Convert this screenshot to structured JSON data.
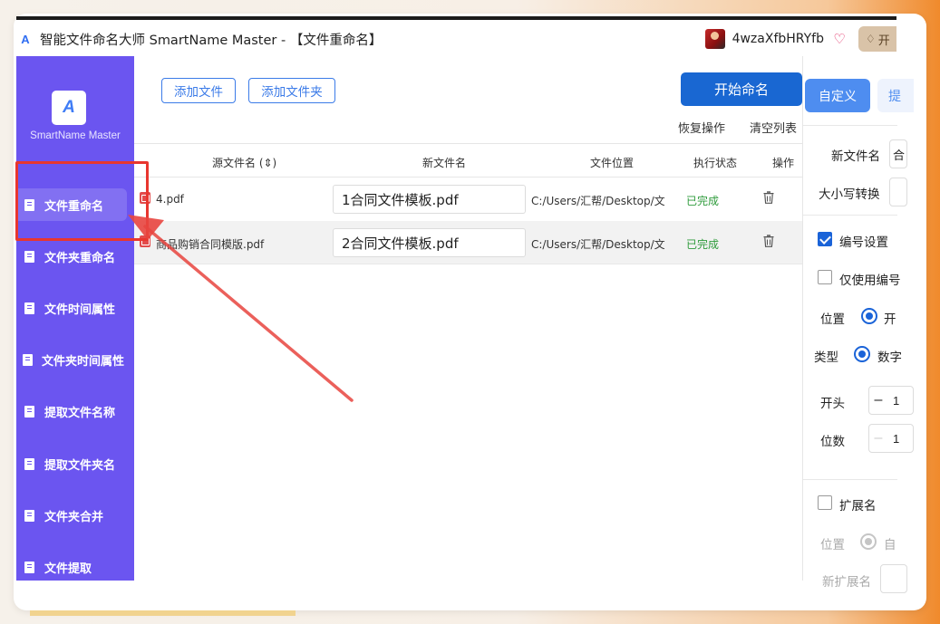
{
  "window": {
    "title": "智能文件命名大师 SmartName Master - 【文件重命名】",
    "username": "4wzaXfbHRYfb",
    "open_vip_label": "开"
  },
  "sidebar": {
    "logo_text": "SmartName Master",
    "items": [
      {
        "label": "文件重命名",
        "active": true
      },
      {
        "label": "文件夹重命名",
        "active": false
      },
      {
        "label": "文件时间属性",
        "active": false
      },
      {
        "label": "文件夹时间属性",
        "active": false
      },
      {
        "label": "提取文件名称",
        "active": false
      },
      {
        "label": "提取文件夹名",
        "active": false
      },
      {
        "label": "文件夹合并",
        "active": false
      },
      {
        "label": "文件提取",
        "active": false
      }
    ]
  },
  "toolbar": {
    "add_file": "添加文件",
    "add_folder": "添加文件夹",
    "start": "开始命名",
    "restore": "恢复操作",
    "clear": "清空列表"
  },
  "table": {
    "headers": [
      "源文件名 (⇕)",
      "新文件名",
      "文件位置",
      "执行状态",
      "操作"
    ],
    "rows": [
      {
        "source": "4.pdf",
        "new_name": "1合同文件模板.pdf",
        "path": "C:/Users/汇帮/Desktop/文件",
        "status": "已完成"
      },
      {
        "source": "商品购销合同模版.pdf",
        "new_name": "2合同文件模板.pdf",
        "path": "C:/Users/汇帮/Desktop/文件",
        "status": "已完成"
      }
    ]
  },
  "right_panel": {
    "tab_custom": "自定义",
    "tab_other": "提",
    "new_filename_label": "新文件名",
    "new_filename_value": "合",
    "case_label": "大小写转换",
    "numbering_label": "编号设置",
    "numbering_checked": true,
    "only_number_label": "仅使用编号",
    "only_number_checked": false,
    "position_label": "位置",
    "position_value": "开",
    "type_label": "类型",
    "type_value": "数字",
    "start_label": "开头",
    "start_value": "1",
    "digits_label": "位数",
    "digits_value": "1",
    "ext_label": "扩展名",
    "ext_checked": false,
    "ext_position_label": "位置",
    "ext_position_value": "自",
    "new_ext_label": "新扩展名"
  }
}
